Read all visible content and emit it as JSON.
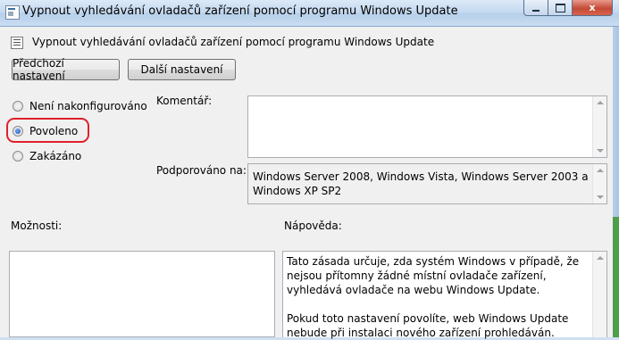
{
  "window": {
    "title": "Vypnout vyhledávání ovladačů zařízení pomocí programu Windows Update",
    "controls": {
      "close": "x"
    }
  },
  "header": {
    "title": "Vypnout vyhledávání ovladačů zařízení pomocí programu Windows Update"
  },
  "nav": {
    "previous": "Předchozí nastavení",
    "next": "Další nastavení"
  },
  "state": {
    "options": [
      {
        "label": "Není nakonfigurováno",
        "checked": false
      },
      {
        "label": "Povoleno",
        "checked": true
      },
      {
        "label": "Zakázáno",
        "checked": false
      }
    ]
  },
  "comment": {
    "label": "Komentář:",
    "value": ""
  },
  "supported": {
    "label": "Podporováno na:",
    "value": "Windows Server 2008, Windows Vista, Windows Server 2003 a Windows XP SP2"
  },
  "options_panel": {
    "label": "Možnosti:"
  },
  "help": {
    "label": "Nápověda:",
    "paragraphs": [
      "Tato zásada určuje, zda systém Windows v případě, že nejsou přítomny žádné místní ovladače zařízení, vyhledává ovladače na webu Windows Update.",
      "Pokud toto nastavení povolíte, web Windows Update nebude při instalaci nového zařízení prohledáván."
    ]
  },
  "colors": {
    "highlight": "#e0202a",
    "close_button": "#c44b37"
  }
}
